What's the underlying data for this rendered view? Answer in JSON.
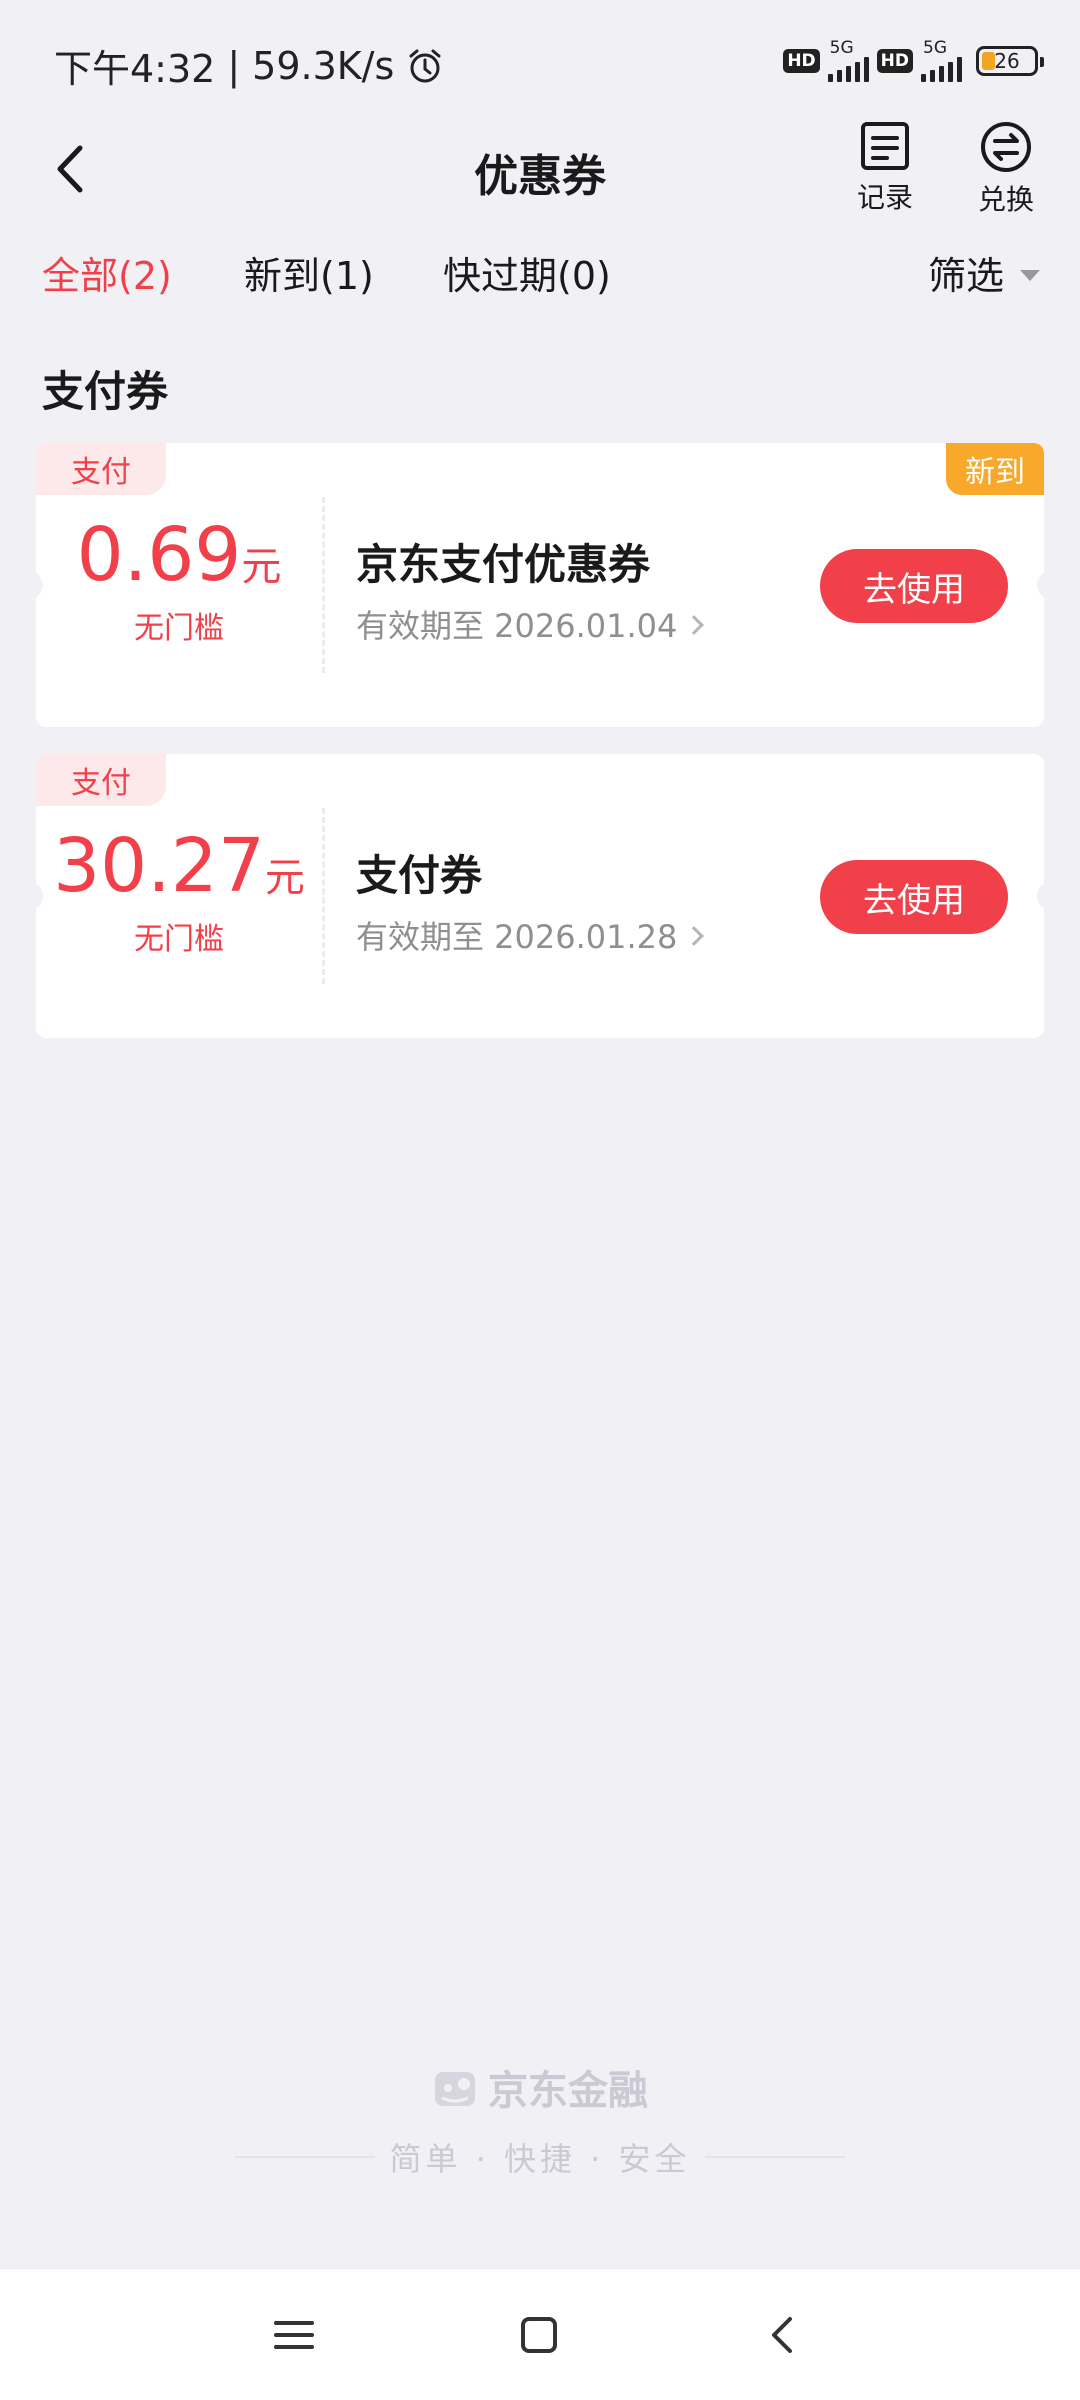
{
  "status_bar": {
    "time": "下午4:32",
    "separator": "|",
    "net_speed": "59.3K/s",
    "hd1": "HD",
    "gen1": "5G",
    "hd2": "HD",
    "gen2": "5G",
    "battery": "26"
  },
  "header": {
    "title": "优惠券",
    "record_label": "记录",
    "exchange_label": "兑换"
  },
  "tabs": {
    "all": "全部(2)",
    "new": "新到(1)",
    "expiring": "快过期(0)",
    "filter": "筛选",
    "active_tab": "all"
  },
  "section": {
    "title": "支付券"
  },
  "coupons": [
    {
      "type_tag": "支付",
      "new_tag": "新到",
      "amount": "0.69",
      "unit": "元",
      "threshold": "无门槛",
      "name": "京东支付优惠券",
      "validity": "有效期至 2026.01.04",
      "button": "去使用"
    },
    {
      "type_tag": "支付",
      "amount": "30.27",
      "unit": "元",
      "threshold": "无门槛",
      "name": "支付券",
      "validity": "有效期至 2026.01.28",
      "button": "去使用"
    }
  ],
  "brand": {
    "name": "京东金融",
    "slogan": "简单 · 快捷 · 安全"
  },
  "colors": {
    "accent": "#f2404b",
    "new_tag": "#f8a92b",
    "background": "#f1f0f5"
  }
}
